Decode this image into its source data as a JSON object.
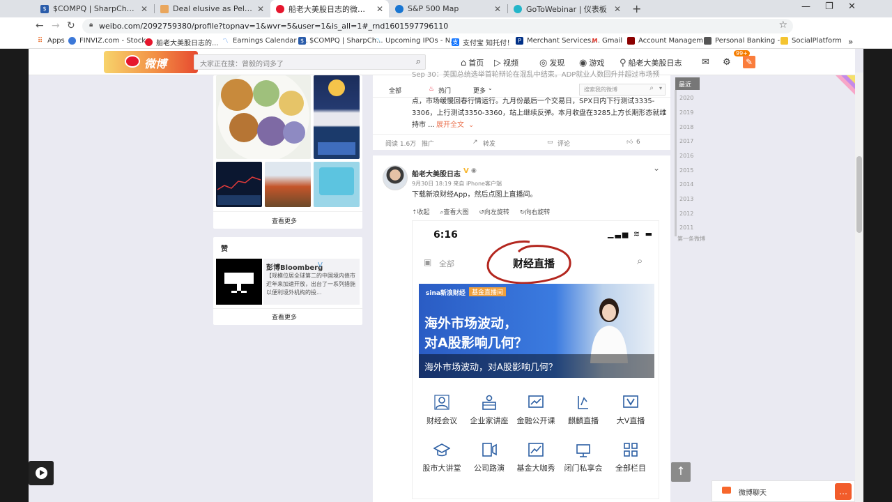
{
  "tabs": [
    {
      "title": "$COMPQ | SharpChart | StockCh",
      "fav_color": "#2a5caa",
      "fav_glyph": "$"
    },
    {
      "title": "Deal elusive as Pelosi, Mnuchin o",
      "fav_color": "#e9a65d",
      "fav_glyph": ""
    },
    {
      "title": "船老大美股日志的微博_微博",
      "fav_color": "#e6162d",
      "fav_glyph": ""
    },
    {
      "title": "S&P 500 Map",
      "fav_color": "#1976d2",
      "fav_glyph": ""
    },
    {
      "title": "GoToWebinar | 仪表板",
      "fav_color": "#23b5c9",
      "fav_glyph": ""
    }
  ],
  "address": {
    "url": "weibo.com/2092759380/profile?topnav=1&wvr=5&user=1&is_all=1#_rnd1601597796110"
  },
  "bookmarks": [
    {
      "label": "Apps",
      "icon": "apps-grid-icon",
      "color": "#4285f4"
    },
    {
      "label": "FINVIZ.com - Stock...",
      "icon": "finviz-icon",
      "color": "#3c78d8"
    },
    {
      "label": "船老大美股日志的...",
      "icon": "weibo-icon",
      "color": "#e6162d"
    },
    {
      "label": "Earnings Calendar -...",
      "icon": "chart-icon",
      "color": "#1a73e8"
    },
    {
      "label": "$COMPQ | SharpCh...",
      "icon": "stockcharts-icon",
      "color": "#2a5caa"
    },
    {
      "label": "Upcoming IPOs - N...",
      "icon": "nasdaq-icon",
      "color": "#0096d6"
    },
    {
      "label": "支付宝 知托付！",
      "icon": "alipay-icon",
      "color": "#1677ff"
    },
    {
      "label": "Merchant Services,...",
      "icon": "paypal-icon",
      "color": "#003087"
    },
    {
      "label": "Gmail",
      "icon": "gmail-icon",
      "color": "#d93025"
    },
    {
      "label": "Account Managem...",
      "icon": "account-icon",
      "color": "#8b0000"
    },
    {
      "label": "Personal Banking -...",
      "icon": "bank-icon",
      "color": "#555555"
    },
    {
      "label": "SocialPlatform",
      "icon": "folder-icon",
      "color": "#f4c430"
    }
  ],
  "weibo": {
    "logo_text": "微博",
    "search_placeholder": "大家正在搜：曾毅的词多了",
    "nav": [
      {
        "label": "首页",
        "icon": "home-icon"
      },
      {
        "label": "视频",
        "icon": "video-icon"
      },
      {
        "label": "发现",
        "icon": "discover-icon"
      },
      {
        "label": "游戏",
        "icon": "game-icon"
      },
      {
        "label": "船老大美股日志",
        "icon": "user-icon"
      }
    ],
    "msg_badge": "99+"
  },
  "left": {
    "photo_more": "查看更多",
    "zan_title": "赞",
    "bloomberg_name": "彭博Bloomberg",
    "bloomberg_text": "【规模位居全球第二的中国境内债市近年来加速开放，出台了一系列措施以便利境外机构的投...",
    "zan_more": "查看更多"
  },
  "post1": {
    "text_top": "Sep 30：美国总统选举首轮辩论在混乱中结束。ADP就业人数回升并超过市场预",
    "text_l2": "点，市场缓慢回春行情运行。九月份最后一个交易日，SPX日内下行测试3335-",
    "text_l3": "3306，上行测试3350-3360，站上继续反弹。本月收盘在3285上方长期形态就维",
    "text_l4": "持市 ...",
    "expand": "展开全文",
    "filter_tabs": [
      "全部",
      "热门",
      "更多"
    ],
    "filter_search_placeholder": "搜索我的微博",
    "stats": {
      "reads": "阅读 1.6万",
      "promote": "推广",
      "repost": "转发",
      "comment": "评论",
      "likes": "6"
    }
  },
  "post2": {
    "author": "船老大美股日志",
    "meta": "9月30日 18:19 来自 iPhone客户端",
    "text": "下载新浪财经App，然后点图上直播间。",
    "tools": [
      "收起",
      "查看大图",
      "向左旋转",
      "向右旋转"
    ],
    "phone": {
      "time": "6:16",
      "all_label": "全部",
      "title": "财经直播",
      "banner_brand": "sina新浪财经",
      "banner_tag": "基金直播间",
      "banner_line1": "海外市场波动，",
      "banner_line2": "对A股影响几何？",
      "banner_caption": "海外市场波动，对A股影响几何？",
      "services_row1": [
        {
          "label": "财经会议",
          "icon": "meeting-icon"
        },
        {
          "label": "企业家讲座",
          "icon": "lecture-icon"
        },
        {
          "label": "金融公开课",
          "icon": "class-icon"
        },
        {
          "label": "麒麟直播",
          "icon": "live-icon"
        },
        {
          "label": "大V直播",
          "icon": "vip-live-icon"
        }
      ],
      "services_row2": [
        {
          "label": "股市大讲堂",
          "icon": "graduation-icon"
        },
        {
          "label": "公司路演",
          "icon": "roadshow-icon"
        },
        {
          "label": "基金大咖秀",
          "icon": "fund-icon"
        },
        {
          "label": "闭门私享会",
          "icon": "private-icon"
        },
        {
          "label": "全部栏目",
          "icon": "grid-icon"
        }
      ]
    }
  },
  "timeline": {
    "current": "最近",
    "years": [
      "2020",
      "2019",
      "2018",
      "2017",
      "2016",
      "2015",
      "2014",
      "2013",
      "2012",
      "2011"
    ],
    "first": "第一条微博"
  },
  "chat_label": "微博聊天"
}
